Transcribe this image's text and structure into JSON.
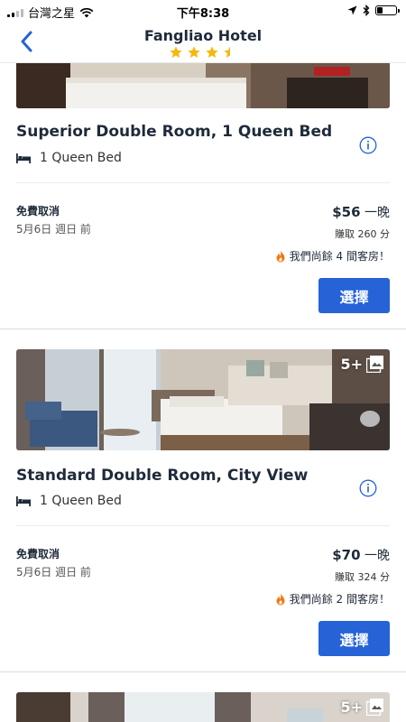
{
  "status_bar": {
    "carrier": "台灣之星",
    "time": "下午8:38"
  },
  "nav": {
    "title": "Fangliao Hotel",
    "star_rating": 3.5
  },
  "rooms": [
    {
      "title": "Superior Double Room, 1 Queen Bed",
      "bed": "1 Queen Bed",
      "cancellation": "免費取消",
      "cancel_date": "5月6日 週日 前",
      "price": "$56",
      "per_night": "一晚",
      "points": "賺取 260 分",
      "rooms_left": "我們尚餘 4 間客房！",
      "select_label": "選擇"
    },
    {
      "title": "Standard Double Room, City View",
      "bed": "1 Queen Bed",
      "photo_count": "5+",
      "cancellation": "免費取消",
      "cancel_date": "5月6日 週日 前",
      "price": "$70",
      "per_night": "一晚",
      "points": "賺取 324 分",
      "rooms_left": "我們尚餘 2 間客房！",
      "select_label": "選擇"
    },
    {
      "photo_count": "5+"
    }
  ],
  "colors": {
    "accent": "#2563d6",
    "star": "#f5b90a",
    "fire": "#f07a12"
  }
}
